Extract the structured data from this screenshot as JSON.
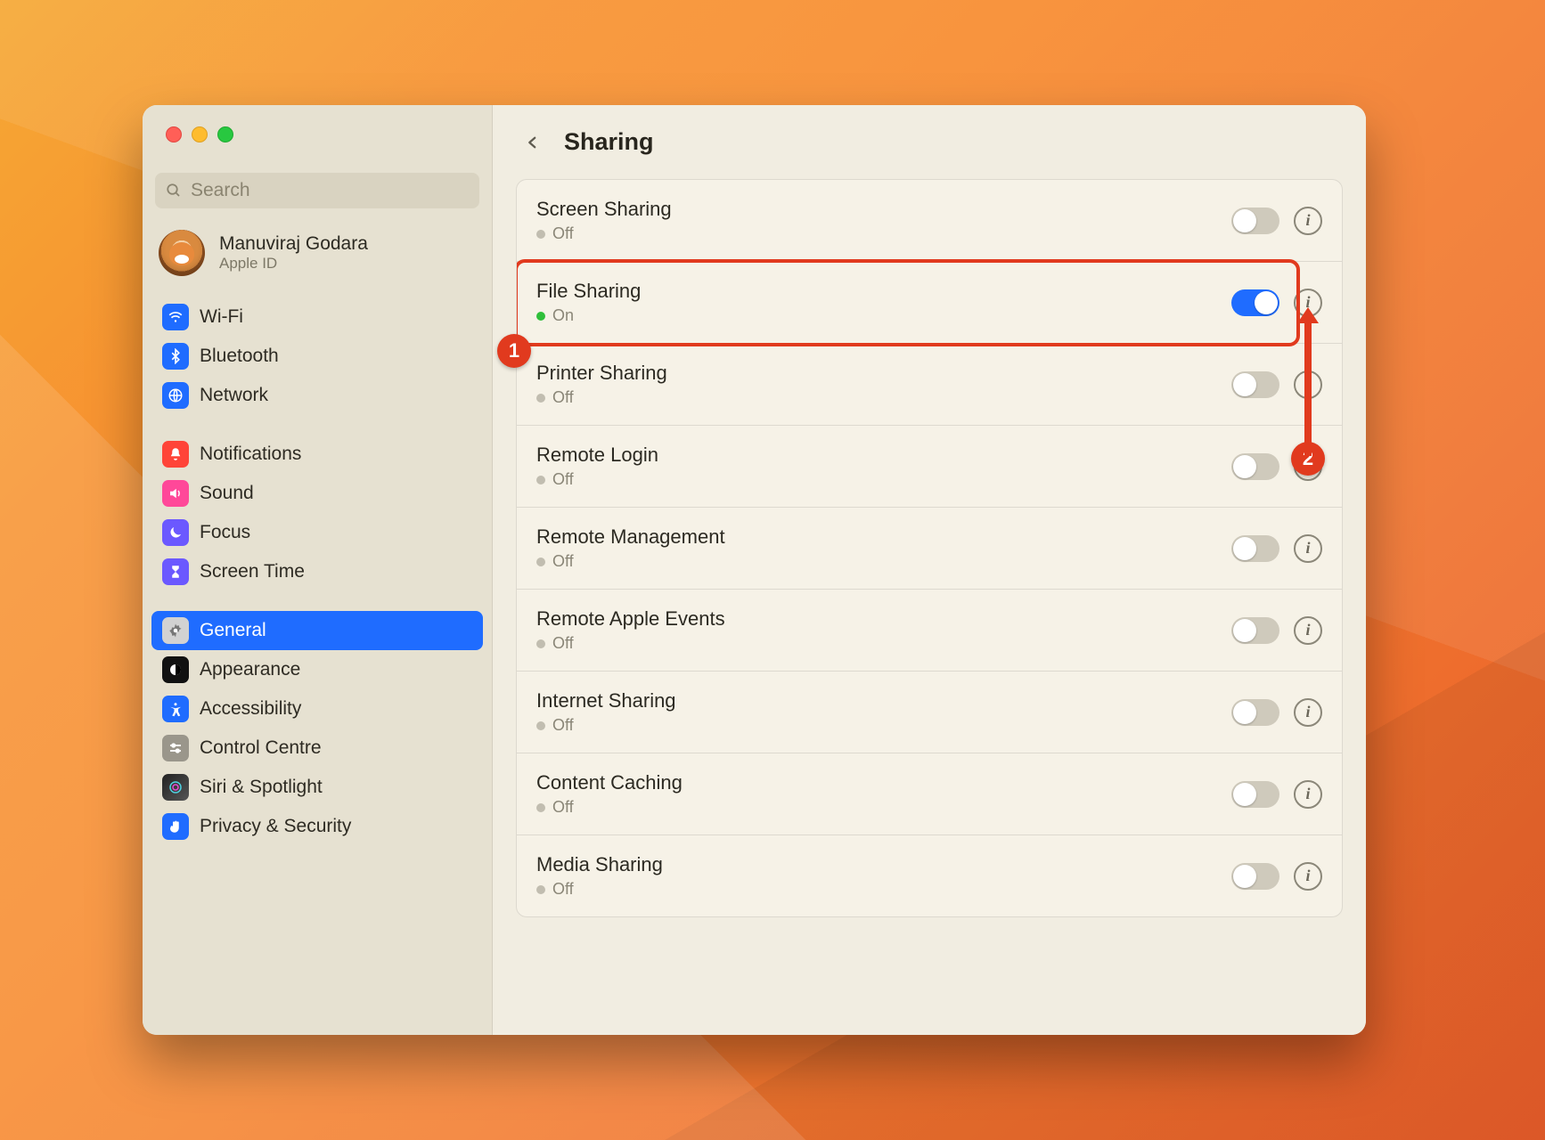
{
  "header": {
    "title": "Sharing"
  },
  "search": {
    "placeholder": "Search"
  },
  "account": {
    "name": "Manuviraj Godara",
    "subtitle": "Apple ID"
  },
  "sidebar": {
    "groups": [
      {
        "items": [
          "Wi-Fi",
          "Bluetooth",
          "Network"
        ]
      },
      {
        "items": [
          "Notifications",
          "Sound",
          "Focus",
          "Screen Time"
        ]
      },
      {
        "items": [
          "General",
          "Appearance",
          "Accessibility",
          "Control Centre",
          "Siri & Spotlight",
          "Privacy & Security"
        ]
      }
    ],
    "selected": "General"
  },
  "status_text": {
    "on": "On",
    "off": "Off"
  },
  "services": [
    {
      "name": "Screen Sharing",
      "status": "off",
      "enabled": false
    },
    {
      "name": "File Sharing",
      "status": "on",
      "enabled": true,
      "highlighted": true
    },
    {
      "name": "Printer Sharing",
      "status": "off",
      "enabled": false
    },
    {
      "name": "Remote Login",
      "status": "off",
      "enabled": false
    },
    {
      "name": "Remote Management",
      "status": "off",
      "enabled": false
    },
    {
      "name": "Remote Apple Events",
      "status": "off",
      "enabled": false
    },
    {
      "name": "Internet Sharing",
      "status": "off",
      "enabled": false
    },
    {
      "name": "Content Caching",
      "status": "off",
      "enabled": false
    },
    {
      "name": "Media Sharing",
      "status": "off",
      "enabled": false
    }
  ],
  "annotations": {
    "callout1": "1",
    "callout2": "2",
    "callout1_target": "File Sharing row",
    "callout2_target": "File Sharing info button"
  },
  "colors": {
    "accent_blue": "#1f6cff",
    "annotation_red": "#e13a1e",
    "status_on_green": "#2fbf3a"
  }
}
